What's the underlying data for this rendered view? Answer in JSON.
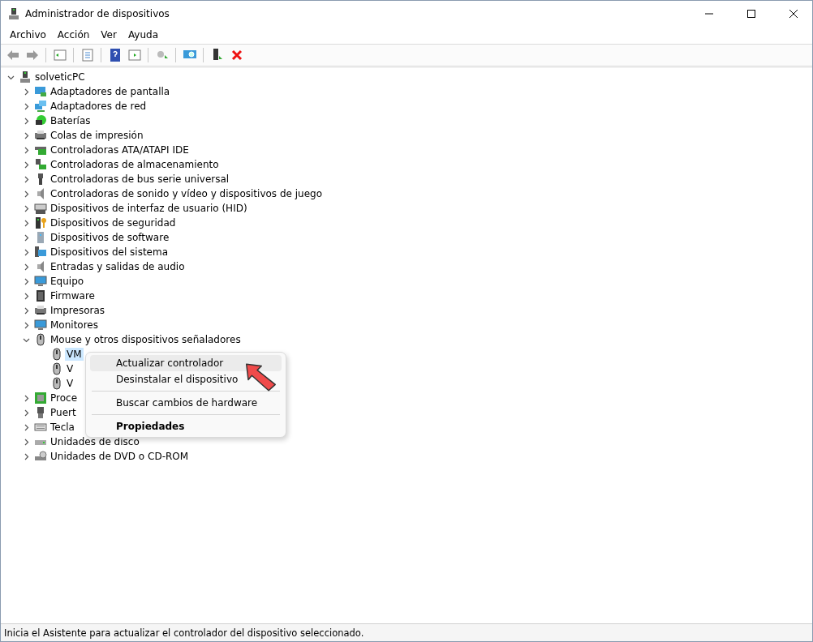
{
  "window": {
    "title": "Administrador de dispositivos"
  },
  "menu_bar": [
    "Archivo",
    "Acción",
    "Ver",
    "Ayuda"
  ],
  "tree": {
    "label": "solveticPC",
    "kind": "computer",
    "expanded": true,
    "children": [
      {
        "label": "Adaptadores de pantalla",
        "kind": "display",
        "expanded": false
      },
      {
        "label": "Adaptadores de red",
        "kind": "network",
        "expanded": false
      },
      {
        "label": "Baterías",
        "kind": "battery",
        "expanded": false
      },
      {
        "label": "Colas de impresión",
        "kind": "printer",
        "expanded": false
      },
      {
        "label": "Controladoras ATA/ATAPI IDE",
        "kind": "card",
        "expanded": false
      },
      {
        "label": "Controladoras de almacenamiento",
        "kind": "storage",
        "expanded": false
      },
      {
        "label": "Controladoras de bus serie universal",
        "kind": "usb",
        "expanded": false
      },
      {
        "label": "Controladoras de sonido y vídeo y dispositivos de juego",
        "kind": "speaker",
        "expanded": false
      },
      {
        "label": "Dispositivos de interfaz de usuario (HID)",
        "kind": "hid",
        "expanded": false
      },
      {
        "label": "Dispositivos de seguridad",
        "kind": "security",
        "expanded": false
      },
      {
        "label": "Dispositivos de software",
        "kind": "software",
        "expanded": false
      },
      {
        "label": "Dispositivos del sistema",
        "kind": "system",
        "expanded": false
      },
      {
        "label": "Entradas y salidas de audio",
        "kind": "speaker",
        "expanded": false
      },
      {
        "label": "Equipo",
        "kind": "monitor",
        "expanded": false
      },
      {
        "label": "Firmware",
        "kind": "chip",
        "expanded": false
      },
      {
        "label": "Impresoras",
        "kind": "printer",
        "expanded": false
      },
      {
        "label": "Monitores",
        "kind": "monitor",
        "expanded": false
      },
      {
        "label": "Mouse y otros dispositivos señaladores",
        "kind": "mouse",
        "expanded": true,
        "children": [
          {
            "label": "VM",
            "kind": "mouse",
            "selected": true
          },
          {
            "label": "V",
            "kind": "mouse",
            "selected": false
          },
          {
            "label": "V",
            "kind": "mouse",
            "selected": false
          }
        ]
      },
      {
        "label": "Proce",
        "kind": "cpu",
        "expanded": false
      },
      {
        "label": "Puert",
        "kind": "port",
        "expanded": false
      },
      {
        "label": "Tecla",
        "kind": "keyboard",
        "expanded": false
      },
      {
        "label": "Unidades de disco",
        "kind": "disk",
        "expanded": false
      },
      {
        "label": "Unidades de DVD o CD-ROM",
        "kind": "dvd",
        "expanded": false
      }
    ]
  },
  "context_menu": [
    {
      "kind": "item",
      "label": "Actualizar controlador",
      "highlighted": true,
      "bold": false
    },
    {
      "kind": "item",
      "label": "Desinstalar el dispositivo",
      "highlighted": false,
      "bold": false
    },
    {
      "kind": "separator"
    },
    {
      "kind": "item",
      "label": "Buscar cambios de hardware",
      "highlighted": false,
      "bold": false
    },
    {
      "kind": "separator"
    },
    {
      "kind": "item",
      "label": "Propiedades",
      "highlighted": false,
      "bold": true
    }
  ],
  "status_bar": "Inicia el Asistente para actualizar el controlador del dispositivo seleccionado."
}
